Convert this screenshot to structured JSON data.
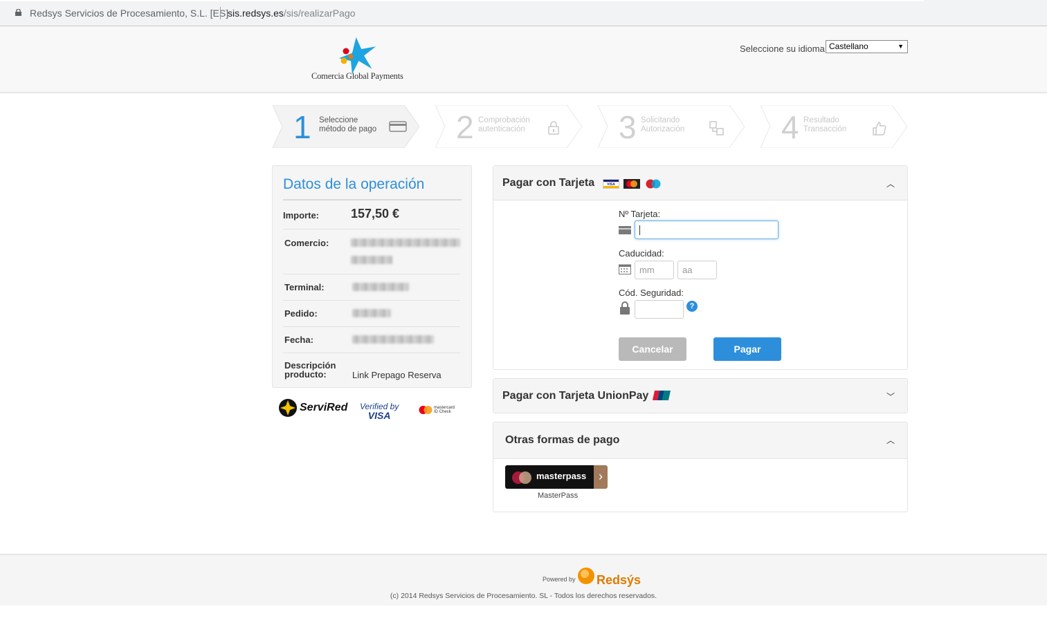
{
  "browser": {
    "site_name": "Redsys Servicios de Procesamiento, S.L. [ES]",
    "url_domain": "sis.redsys.es",
    "url_path": "/sis/realizarPago"
  },
  "header": {
    "logo_text": "Comercia Global Payments",
    "language_label": "Seleccione su idioma",
    "language_value": "Castellano"
  },
  "steps": [
    {
      "number": "1",
      "line1": "Seleccione",
      "line2": "método de pago",
      "icon": "card-icon",
      "active": true
    },
    {
      "number": "2",
      "line1": "Comprobación",
      "line2": "autenticación",
      "icon": "lock-icon",
      "active": false
    },
    {
      "number": "3",
      "line1": "Solicitando",
      "line2": "Autorización",
      "icon": "transfer-icon",
      "active": false
    },
    {
      "number": "4",
      "line1": "Resultado",
      "line2": "Transacción",
      "icon": "thumbs-up-icon",
      "active": false
    }
  ],
  "operation": {
    "title": "Datos de la operación",
    "amount_label": "Importe:",
    "amount_value": "157,50 €",
    "merchant_label": "Comercio:",
    "terminal_label": "Terminal:",
    "order_label": "Pedido:",
    "date_label": "Fecha:",
    "description_label_1": "Descripción",
    "description_label_2": "producto:",
    "description_value": "Link Prepago Reserva"
  },
  "badges": {
    "servired": "ServiRed",
    "verified_1": "Verified by",
    "verified_2": "VISA",
    "mastercard_1": "mastercard",
    "mastercard_2": "ID Check"
  },
  "card_payment": {
    "title": "Pagar con Tarjeta",
    "card_number_label": "Nº Tarjeta:",
    "card_number_value": "",
    "expiry_label": "Caducidad:",
    "month_placeholder": "mm",
    "year_placeholder": "aa",
    "cvv_label": "Cód. Seguridad:",
    "cancel_label": "Cancelar",
    "pay_label": "Pagar",
    "help_icon": "?"
  },
  "unionpay": {
    "title": "Pagar con Tarjeta UnionPay"
  },
  "other": {
    "title": "Otras formas de pago",
    "masterpass_button": "masterpass",
    "masterpass_label": "MasterPass"
  },
  "footer": {
    "powered_by": "Powered by",
    "brand": "Redsýs",
    "copyright": "(c) 2014 Redsys Servicios de Procesamiento. SL - Todos los derechos reservados."
  },
  "colors": {
    "accent": "#2d8fdb",
    "cancel": "#b9b9b9",
    "redsys_orange": "#f39200",
    "caixa_blue": "#1ea4e0"
  }
}
